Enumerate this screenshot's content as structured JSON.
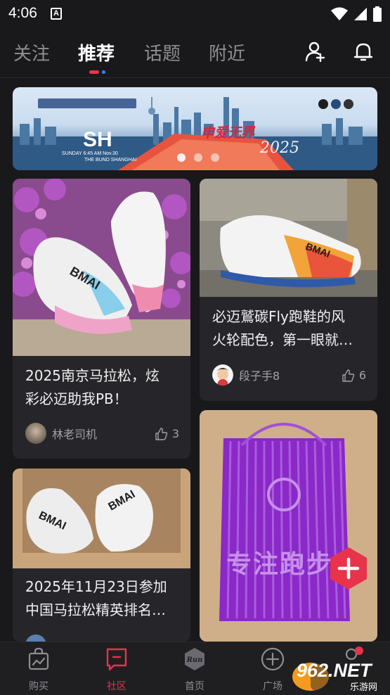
{
  "status_bar": {
    "time": "4:06",
    "notification_letter": "A"
  },
  "top_nav": {
    "tabs": [
      {
        "label": "关注",
        "active": false
      },
      {
        "label": "推荐",
        "active": true
      },
      {
        "label": "话题",
        "active": false
      },
      {
        "label": "附近",
        "active": false
      }
    ],
    "icons": [
      "add-friend-icon",
      "bell-icon"
    ]
  },
  "banner": {
    "city_code": "SH",
    "subtitle": "SUNDAY 6:45 AM Nov.30",
    "location": "THE BUND SHANGHAI",
    "year": "2025",
    "slogan": "申爱无界",
    "slides": 3
  },
  "feed": {
    "left": [
      {
        "title": "2025南京马拉松，炫彩必迈助我PB！",
        "title_lines": [
          "2025南京马拉松，炫",
          "彩必迈助我PB！"
        ],
        "author": "林老司机",
        "likes": "3"
      },
      {
        "title_lines": [
          "2025年11月23日参加",
          "中国马拉松精英排名…"
        ]
      }
    ],
    "right": [
      {
        "title_lines": [
          "必迈鷲碳Fly跑鞋的风",
          "火轮配色，第一眼就…"
        ],
        "author": "段子手8",
        "likes": "6"
      },
      {
        "image_text": "专注跑步"
      }
    ]
  },
  "bottom_nav": {
    "items": [
      {
        "label": "购买",
        "icon": "shopping-bag-icon",
        "active": false
      },
      {
        "label": "社区",
        "icon": "community-icon",
        "active": true
      },
      {
        "label": "首页",
        "icon": "run-logo-icon",
        "logo_text": "Run",
        "active": false
      },
      {
        "label": "广场",
        "icon": "plus-circle-icon",
        "active": false
      }
    ]
  },
  "watermark": {
    "text": "962.NET",
    "subtext": "乐游网"
  },
  "colors": {
    "background": "#19191b",
    "card": "#26262a",
    "accent_red": "#e8334a",
    "accent_blue": "#2e86ff"
  }
}
